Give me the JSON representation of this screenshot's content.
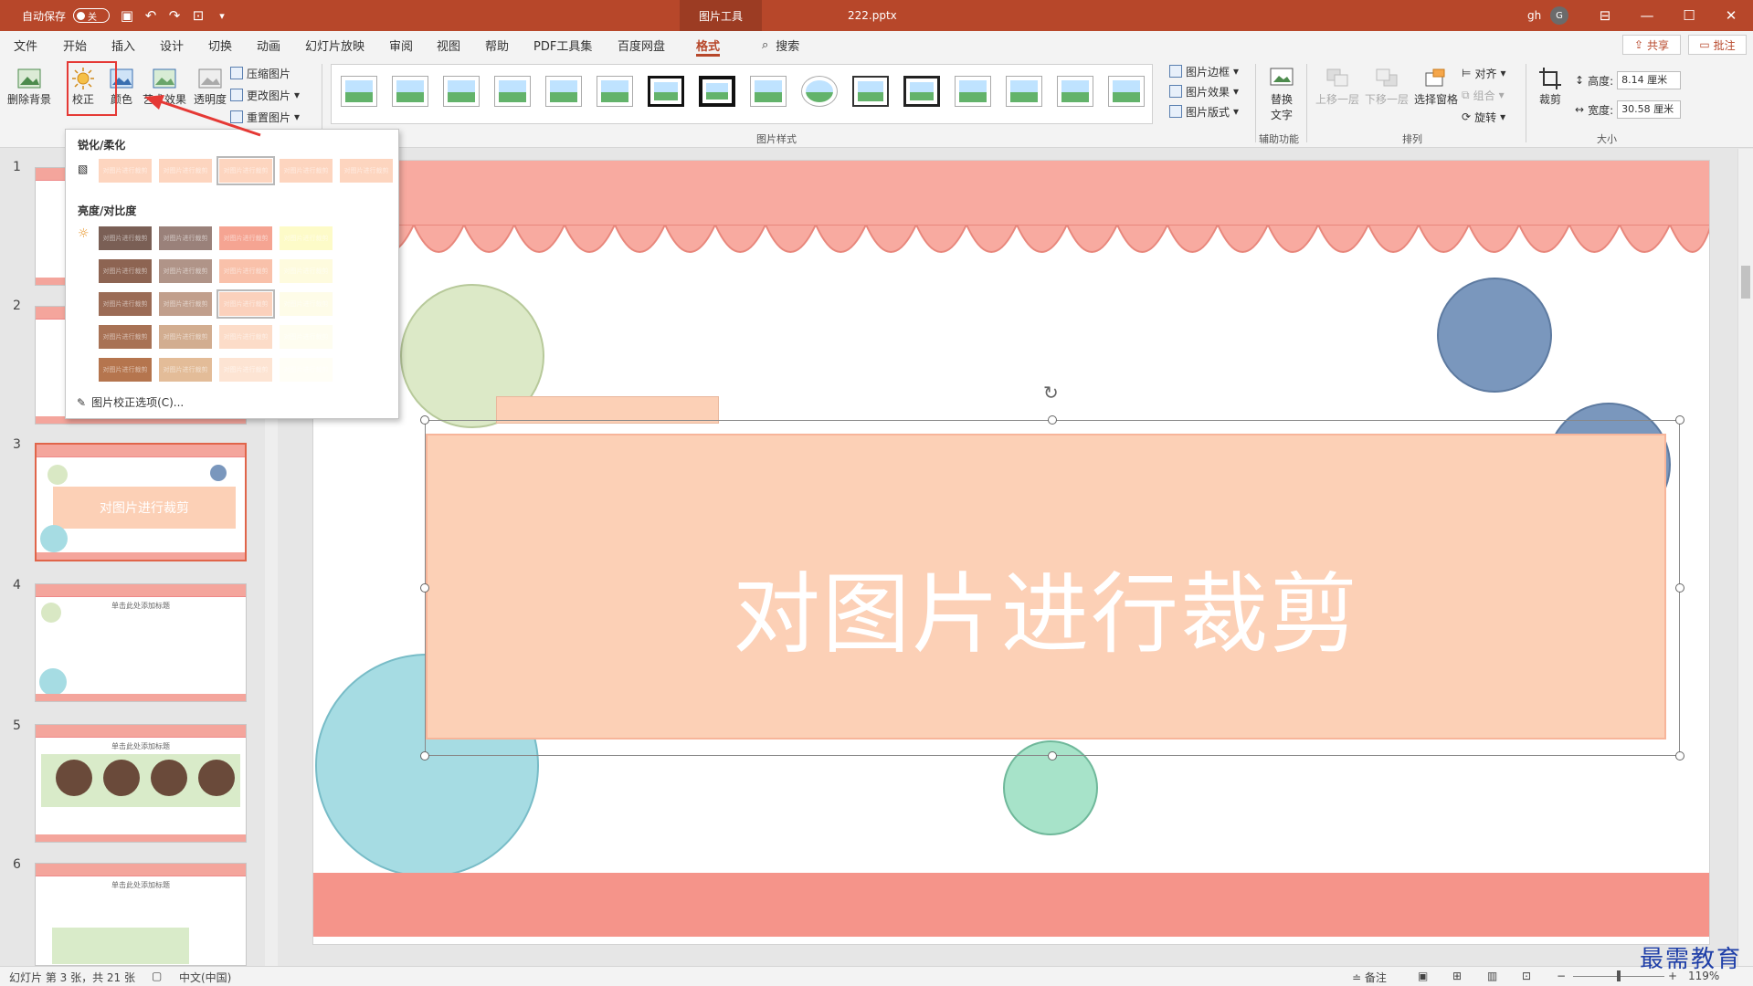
{
  "titlebar": {
    "autosave_label": "自动保存",
    "autosave_state": "关",
    "context_tab": "图片工具",
    "filename": "222.pptx",
    "user": "gh",
    "avatar_letter": "G"
  },
  "menu_tabs": [
    "文件",
    "开始",
    "插入",
    "设计",
    "切换",
    "动画",
    "幻灯片放映",
    "审阅",
    "视图",
    "帮助",
    "PDF工具集",
    "百度网盘",
    "格式"
  ],
  "active_tab": "格式",
  "search_placeholder": "搜索",
  "share_label": "共享",
  "comment_label": "批注",
  "ribbon": {
    "remove_bg": "删除背景",
    "corrections": "校正",
    "color": "颜色",
    "artistic": "艺术效果",
    "transparency": "透明度",
    "compress": "压缩图片",
    "change_picture": "更改图片",
    "reset_picture": "重置图片",
    "picture_styles_group": "图片样式",
    "picture_border": "图片边框",
    "picture_effects": "图片效果",
    "picture_layout": "图片版式",
    "alt_text_1": "替换",
    "alt_text_2": "文字",
    "accessibility_group": "辅助功能",
    "bring_forward": "上移一层",
    "send_backward": "下移一层",
    "selection_pane": "选择窗格",
    "align": "对齐",
    "group": "组合",
    "rotate": "旋转",
    "arrange_group": "排列",
    "crop": "裁剪",
    "height_label": "高度:",
    "height_value": "8.14 厘米",
    "width_label": "宽度:",
    "width_value": "30.58 厘米",
    "size_group": "大小"
  },
  "dropdown": {
    "sharpen_heading": "锐化/柔化",
    "brightness_heading": "亮度/对比度",
    "swatch_text": "对图片进行裁剪",
    "options_link": "图片校正选项(C)..."
  },
  "slides": [
    {
      "num": "1",
      "title": ""
    },
    {
      "num": "2",
      "title": ""
    },
    {
      "num": "3",
      "title": "对图片进行裁剪"
    },
    {
      "num": "4",
      "title": "单击此处添加标题"
    },
    {
      "num": "5",
      "title": "单击此处添加标题"
    },
    {
      "num": "6",
      "title": "单击此处添加标题"
    }
  ],
  "main_slide": {
    "title": "对图片进行裁剪"
  },
  "statusbar": {
    "slide_info": "幻灯片 第 3 张，共 21 张",
    "language": "中文(中国)",
    "notes": "备注",
    "zoom": "119%"
  },
  "watermark": "最需教育",
  "colors": {
    "accent": "#b7472a",
    "slide_banner": "#f8aaa0",
    "text_card": "#fcd0b6"
  }
}
